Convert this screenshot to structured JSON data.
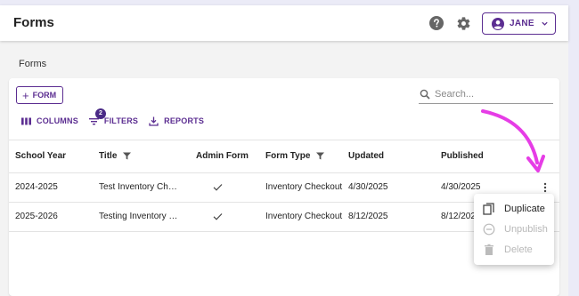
{
  "header": {
    "title": "Forms",
    "help_icon": "help-circle-icon",
    "settings_icon": "gear-icon",
    "user": {
      "name": "JANE",
      "avatar_icon": "account-circle-icon",
      "menu_icon": "chevron-down-icon"
    }
  },
  "breadcrumb": "Forms",
  "toolbar": {
    "add_form_label": "FORM",
    "search_placeholder": "Search...",
    "search_value": "",
    "columns_label": "COLUMNS",
    "filters_label": "FILTERS",
    "filters_count": "2",
    "reports_label": "REPORTS"
  },
  "table": {
    "columns": [
      {
        "label": "School Year",
        "filter": false
      },
      {
        "label": "Title",
        "filter": true
      },
      {
        "label": "Admin Form",
        "filter": false
      },
      {
        "label": "Form Type",
        "filter": true
      },
      {
        "label": "Updated",
        "filter": false
      },
      {
        "label": "Published",
        "filter": false
      }
    ],
    "rows": [
      {
        "school_year": "2024-2025",
        "title": "Test Inventory Ch…",
        "admin_form": true,
        "form_type": "Inventory Checkout",
        "updated": "4/30/2025",
        "published": "4/30/2025"
      },
      {
        "school_year": "2025-2026",
        "title": "Testing Inventory …",
        "admin_form": true,
        "form_type": "Inventory Checkout",
        "updated": "8/12/2025",
        "published": "8/12/2025"
      }
    ]
  },
  "context_menu": {
    "items": [
      {
        "label": "Duplicate",
        "icon": "copy-icon",
        "enabled": true
      },
      {
        "label": "Unpublish",
        "icon": "minus-circle-icon",
        "enabled": false
      },
      {
        "label": "Delete",
        "icon": "trash-icon",
        "enabled": false
      }
    ]
  },
  "colors": {
    "accent": "#5b2d91",
    "annotation_arrow": "#e63de6",
    "page_bg": "#ebebf7"
  }
}
